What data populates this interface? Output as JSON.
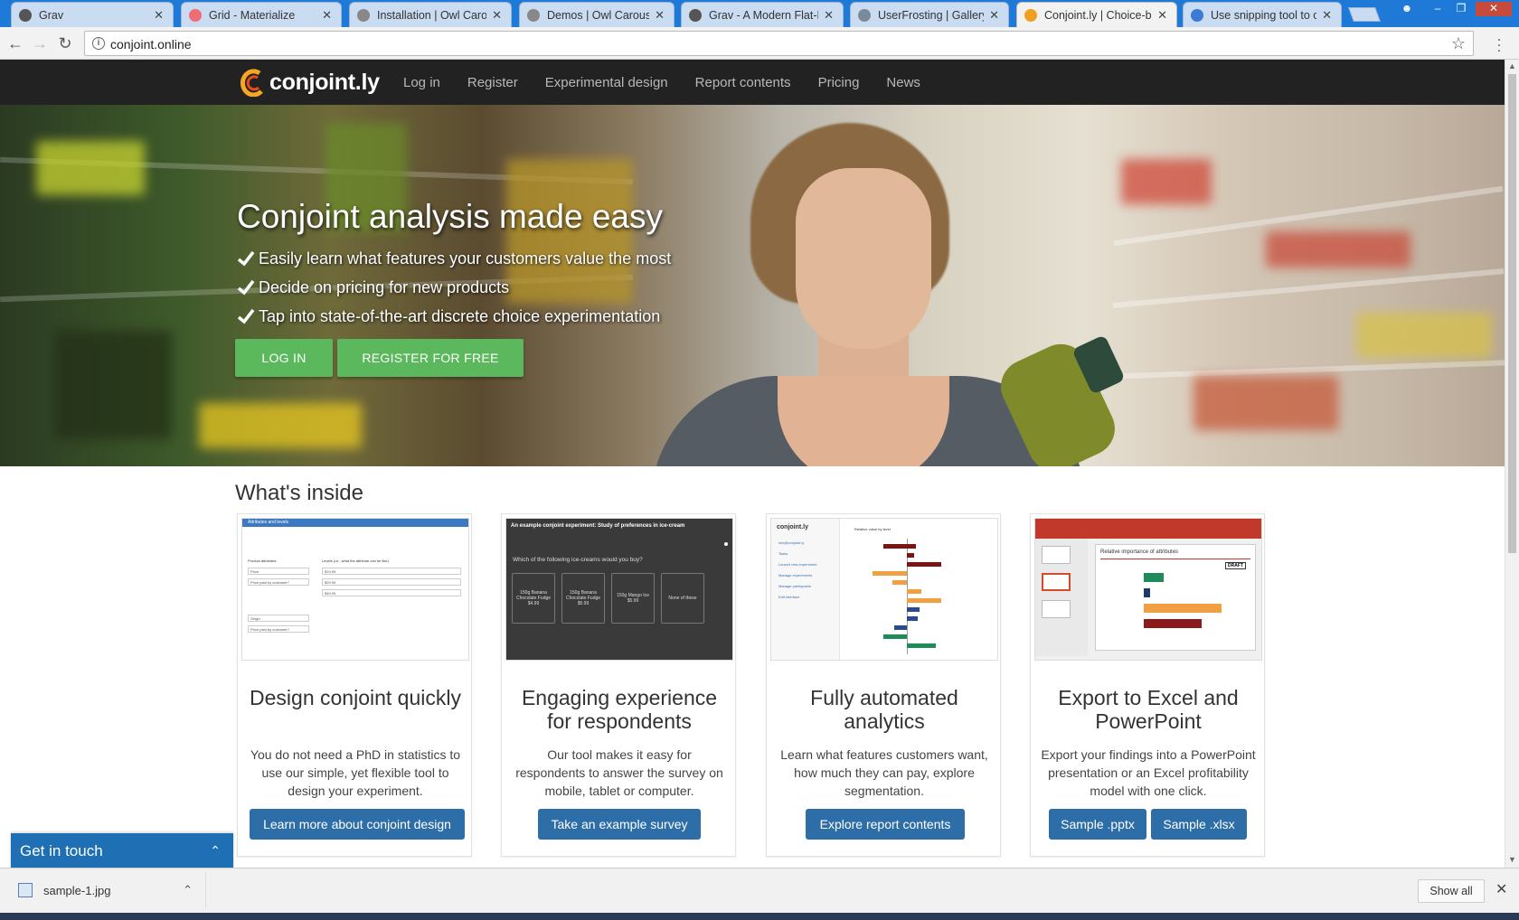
{
  "browser": {
    "tabs": [
      {
        "title": "Grav",
        "favicon": "grav-icon",
        "color": "#555555"
      },
      {
        "title": "Grid - Materialize",
        "favicon": "materialize-icon",
        "color": "#ee6e73"
      },
      {
        "title": "Installation | Owl Carou",
        "favicon": "page-icon",
        "color": "#888888"
      },
      {
        "title": "Demos | Owl Carousel |",
        "favicon": "page-icon",
        "color": "#888888"
      },
      {
        "title": "Grav - A Modern Flat-F",
        "favicon": "grav-icon",
        "color": "#555555"
      },
      {
        "title": "UserFrosting | Gallery",
        "favicon": "userfrosting-icon",
        "color": "#7a8a9a"
      },
      {
        "title": "Conjoint.ly | Choice-ba",
        "favicon": "conjointly-icon",
        "color": "#f0a020",
        "active": true
      },
      {
        "title": "Use snipping tool to ca",
        "favicon": "windows-icon",
        "color": "#3a7bd5"
      }
    ],
    "url": "conjoint.online"
  },
  "site": {
    "logo": "conjoint.ly",
    "nav": [
      "Log in",
      "Register",
      "Experimental design",
      "Report contents",
      "Pricing",
      "News"
    ]
  },
  "hero": {
    "title": "Conjoint analysis made easy",
    "bullets": [
      "Easily learn what features your customers value the most",
      "Decide on pricing for new products",
      "Tap into state-of-the-art discrete choice experimentation"
    ],
    "login_label": "LOG IN",
    "register_label": "REGISTER FOR FREE",
    "button_color": "#5cb85c"
  },
  "section": {
    "title": "What's inside",
    "cards": [
      {
        "title": "Design conjoint quickly",
        "desc": "You do not need a PhD in statistics to use our simple, yet flexible tool to design your experiment.",
        "buttons": [
          "Learn more about conjoint design"
        ]
      },
      {
        "title": "Engaging experience for respondents",
        "desc": "Our tool makes it easy for respondents to answer the survey on mobile, tablet or computer.",
        "buttons": [
          "Take an example survey"
        ]
      },
      {
        "title": "Fully automated analytics",
        "desc": "Learn what features customers want, how much they can pay, explore segmentation.",
        "buttons": [
          "Explore report contents"
        ]
      },
      {
        "title": "Export to Excel and PowerPoint",
        "desc": "Export your findings into a PowerPoint presentation or an Excel profitability model with one click.",
        "buttons": [
          "Sample .pptx",
          "Sample .xlsx"
        ]
      }
    ],
    "button_color": "#2e6ea8"
  },
  "thumbnails": {
    "design": {
      "header": "Attributes and levels",
      "col1": "Product attributes",
      "col2": "Levels (i.e., what the attribute can be like)",
      "rows": [
        "Price",
        "Price paid by customer?",
        "Origin",
        "Price paid by customer?"
      ],
      "levels": [
        "$19.99",
        "$29.99",
        "$49.99"
      ]
    },
    "survey": {
      "header": "An example conjoint experiment: Study of preferences in ice-cream",
      "question": "Which of the following ice-creams would you buy?",
      "options": [
        "150g Banana Chocolate Fudge $4.99",
        "150g Banana Chocolate Fudge $5.99",
        "150g Mango Ice $5.99",
        "None of these"
      ]
    },
    "report": {
      "logo": "conjoint.ly",
      "menu": [
        "info@conjoint.ly",
        "Tasks",
        "Launch new experiment",
        "Manage experiments",
        "Manage participants",
        "Edit interface"
      ],
      "chart_title": "Relative value by level"
    },
    "export": {
      "slide_title": "Relative importance of attributes",
      "badge": "DRAFT"
    }
  },
  "widget": {
    "label": "Get in touch"
  },
  "downloads": {
    "file": "sample-1.jpg",
    "show_all": "Show all"
  }
}
